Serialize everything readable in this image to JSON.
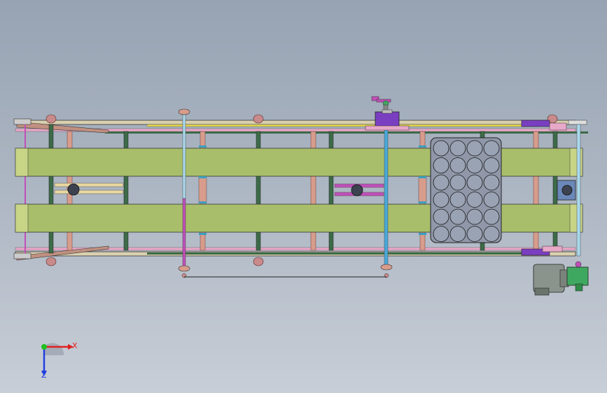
{
  "viewport": {
    "background_top": "#97a3b3",
    "background_bottom": "#c8ced7"
  },
  "colors": {
    "belt": "#a9be6a",
    "frame_dark": "#3d6b48",
    "roller_copper": "#d79c8c",
    "shaft_cyan": "#a9d8ea",
    "shaft_magenta": "#c050b8",
    "bracket_purple": "#7a3fc0",
    "motor_gray": "#8a948c",
    "gearbox_green": "#3fa860",
    "grid_plate": "#8f97a8",
    "top_rail_yellow": "#e8d84a",
    "side_rail_pink": "#e8a8c8"
  },
  "triad": {
    "x_label": "X",
    "z_label": "Z",
    "x_color": "#e02020",
    "y_color": "#20c020",
    "z_color": "#2040e0"
  }
}
